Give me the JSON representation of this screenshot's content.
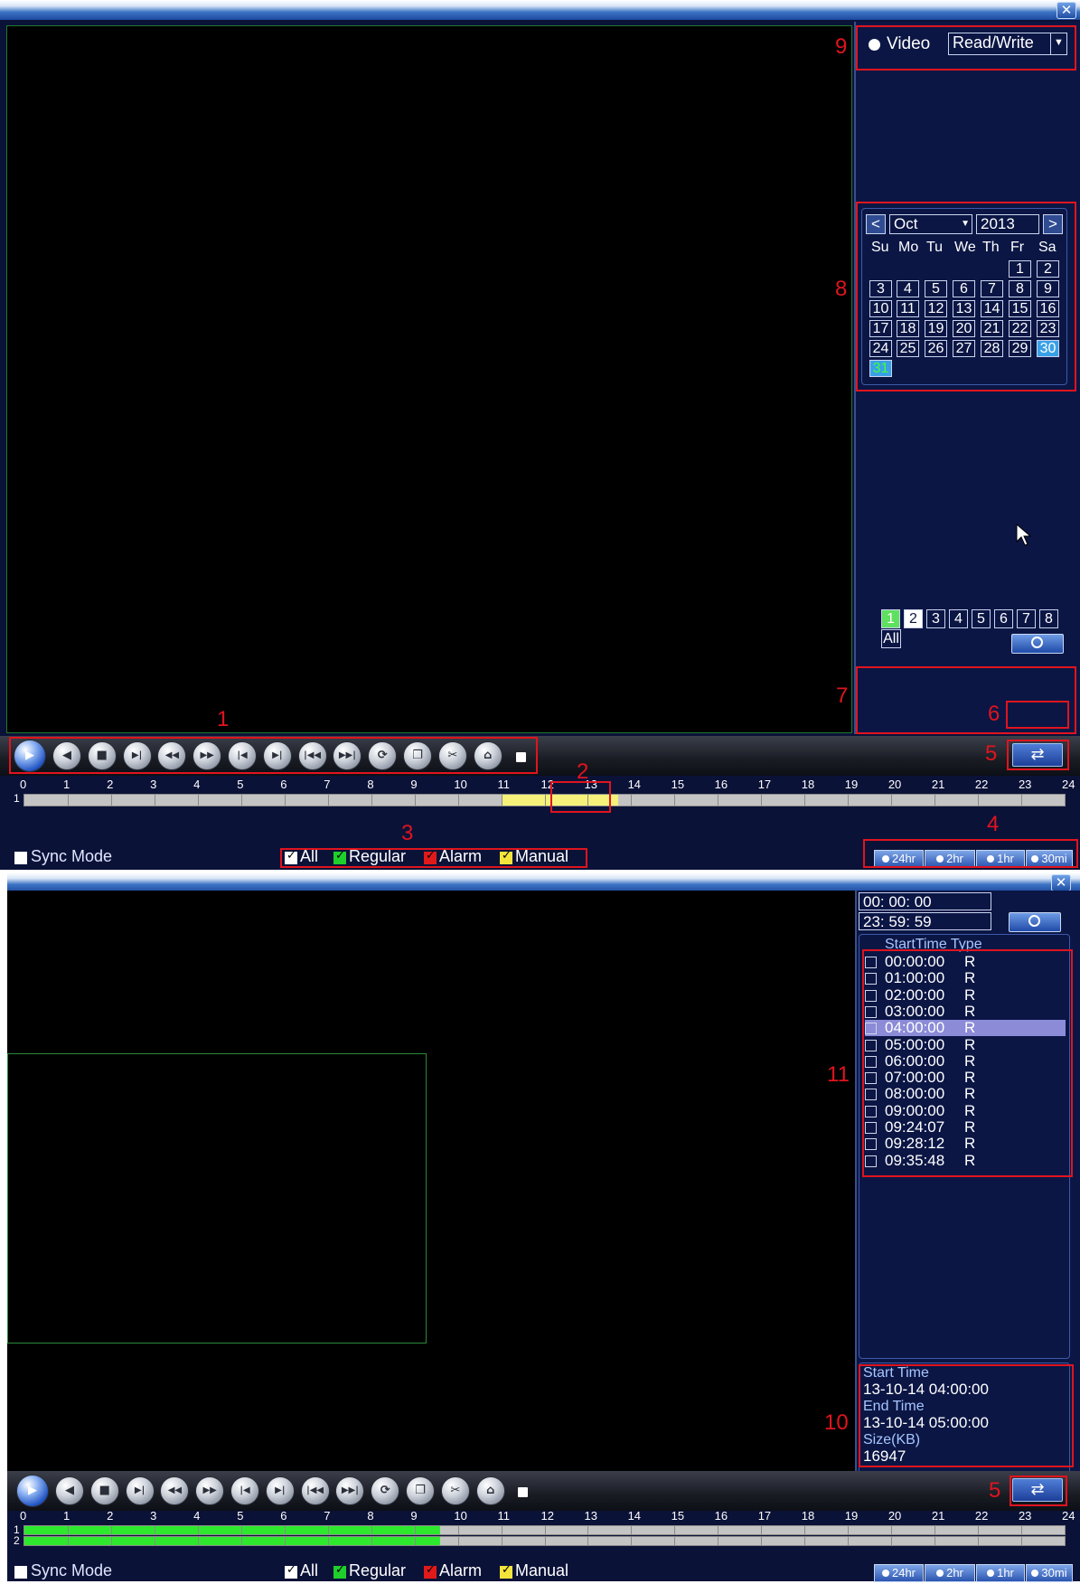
{
  "top_panel": {
    "close_label": "✕",
    "record_source": {
      "option_label": "Video",
      "mode_value": "Read/Write"
    },
    "calendar": {
      "prev_label": "<",
      "next_label": ">",
      "month": "Oct",
      "year": "2013",
      "weekdays": [
        "Su",
        "Mo",
        "Tu",
        "We",
        "Th",
        "Fr",
        "Sa"
      ],
      "days": [
        "1",
        "2",
        "3",
        "4",
        "5",
        "6",
        "7",
        "8",
        "9",
        "10",
        "11",
        "12",
        "13",
        "14",
        "15",
        "16",
        "17",
        "18",
        "19",
        "20",
        "21",
        "22",
        "23",
        "24",
        "25",
        "26",
        "27",
        "28",
        "29",
        "30",
        "31"
      ],
      "first_weekday_index": 2,
      "highlight_blue": "30",
      "highlight_green": "31"
    },
    "channels": {
      "items": [
        "1",
        "2",
        "3",
        "4",
        "5",
        "6",
        "7",
        "8"
      ],
      "active": [
        "1"
      ],
      "selected": [
        "2"
      ],
      "all_label": "All"
    },
    "timeline": {
      "hours": [
        "0",
        "1",
        "2",
        "3",
        "4",
        "5",
        "6",
        "7",
        "8",
        "9",
        "10",
        "11",
        "12",
        "13",
        "14",
        "15",
        "16",
        "17",
        "18",
        "19",
        "20",
        "21",
        "22",
        "23",
        "24"
      ],
      "rows": [
        {
          "label": "1",
          "segments": [
            {
              "start": 11.0,
              "end": 13.7,
              "color": "#f5f17a"
            }
          ]
        }
      ]
    },
    "sync_mode_label": "Sync Mode",
    "legend": [
      {
        "label": "All",
        "color": "#ffffff"
      },
      {
        "label": "Regular",
        "color": "#1fcf2b"
      },
      {
        "label": "Alarm",
        "color": "#e01a1a"
      },
      {
        "label": "Manual",
        "color": "#f2e43a"
      }
    ],
    "zoom_buttons": [
      "24hr",
      "2hr",
      "1hr",
      "30mi"
    ],
    "annotations": {
      "controls": "1",
      "cursor_box": "2",
      "legend": "3",
      "zoom": "4",
      "sync": "5",
      "search": "6",
      "channels": "7",
      "calendar": "8",
      "mode": "9"
    }
  },
  "bottom_panel": {
    "close_label": "✕",
    "start_time": "00: 00: 00",
    "end_time": "23: 59: 59",
    "file_list_header": "StartTime Type",
    "files": [
      {
        "time": "00:00:00",
        "type": "R"
      },
      {
        "time": "01:00:00",
        "type": "R"
      },
      {
        "time": "02:00:00",
        "type": "R"
      },
      {
        "time": "03:00:00",
        "type": "R"
      },
      {
        "time": "04:00:00",
        "type": "R",
        "selected": true
      },
      {
        "time": "05:00:00",
        "type": "R"
      },
      {
        "time": "06:00:00",
        "type": "R"
      },
      {
        "time": "07:00:00",
        "type": "R"
      },
      {
        "time": "08:00:00",
        "type": "R"
      },
      {
        "time": "09:00:00",
        "type": "R"
      },
      {
        "time": "09:24:07",
        "type": "R"
      },
      {
        "time": "09:28:12",
        "type": "R"
      },
      {
        "time": "09:35:48",
        "type": "R"
      }
    ],
    "file_info": {
      "start_label": "Start Time",
      "start_value": "13-10-14 04:00:00",
      "end_label": "End Time",
      "end_value": "13-10-14 05:00:00",
      "size_label": "Size(KB)",
      "size_value": "16947"
    },
    "timeline": {
      "hours": [
        "0",
        "1",
        "2",
        "3",
        "4",
        "5",
        "6",
        "7",
        "8",
        "9",
        "10",
        "11",
        "12",
        "13",
        "14",
        "15",
        "16",
        "17",
        "18",
        "19",
        "20",
        "21",
        "22",
        "23",
        "24"
      ],
      "rows": [
        {
          "label": "1",
          "segments": [
            {
              "start": 0,
              "end": 9.6,
              "color": "#2ee82e"
            }
          ]
        },
        {
          "label": "2",
          "segments": [
            {
              "start": 0,
              "end": 9.6,
              "color": "#2ee82e"
            }
          ]
        }
      ]
    },
    "sync_mode_label": "Sync Mode",
    "legend": [
      {
        "label": "All",
        "color": "#ffffff"
      },
      {
        "label": "Regular",
        "color": "#1fcf2b"
      },
      {
        "label": "Alarm",
        "color": "#e01a1a"
      },
      {
        "label": "Manual",
        "color": "#f2e43a"
      }
    ],
    "zoom_buttons": [
      "24hr",
      "2hr",
      "1hr",
      "30mi"
    ],
    "annotations": {
      "sync": "5",
      "file_info": "10",
      "file_list": "11"
    }
  }
}
